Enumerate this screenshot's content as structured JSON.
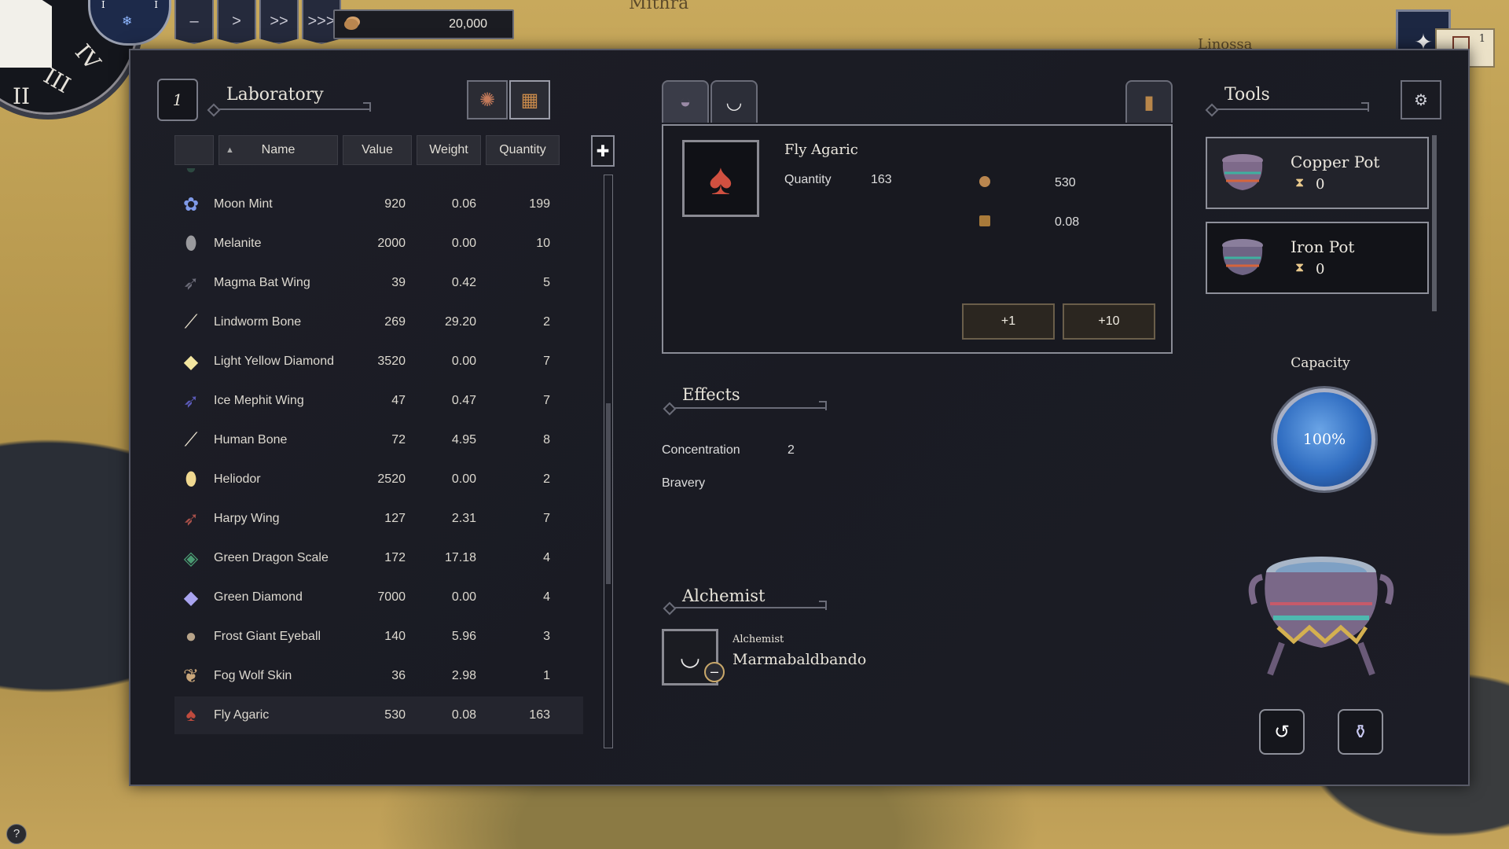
{
  "map": {
    "labels": [
      "Mithra",
      "Linossa"
    ]
  },
  "clock": {
    "numerals": [
      "II",
      "III",
      "IV"
    ],
    "dial_left": "I",
    "dial_right": "I"
  },
  "speed": {
    "buttons": [
      "–",
      ">",
      ">>",
      ">>>"
    ]
  },
  "money": {
    "amount": "20,000"
  },
  "book": {
    "count": "1"
  },
  "laboratory": {
    "badge": "1",
    "title": "Laboratory",
    "columns": [
      "Name",
      "Value",
      "Weight",
      "Quantity"
    ],
    "sort_indicator": "▲",
    "rows": [
      {
        "name": "Moon Mint",
        "value": "920",
        "weight": "0.06",
        "qty": "199",
        "icon": "moon-mint-icon",
        "glyph": "✿",
        "color": "#7f9ae8"
      },
      {
        "name": "Melanite",
        "value": "2000",
        "weight": "0.00",
        "qty": "10",
        "icon": "melanite-icon",
        "glyph": "⬮",
        "color": "#9a9a9e"
      },
      {
        "name": "Magma Bat Wing",
        "value": "39",
        "weight": "0.42",
        "qty": "5",
        "icon": "magma-bat-wing-icon",
        "glyph": "➶",
        "color": "#6b6b78"
      },
      {
        "name": "Lindworm Bone",
        "value": "269",
        "weight": "29.20",
        "qty": "2",
        "icon": "lindworm-bone-icon",
        "glyph": "⟋",
        "color": "#e8e0cc"
      },
      {
        "name": "Light Yellow Diamond",
        "value": "3520",
        "weight": "0.00",
        "qty": "7",
        "icon": "light-yellow-diamond-icon",
        "glyph": "◆",
        "color": "#f3e6a0"
      },
      {
        "name": "Ice Mephit Wing",
        "value": "47",
        "weight": "0.47",
        "qty": "7",
        "icon": "ice-mephit-wing-icon",
        "glyph": "➶",
        "color": "#5b5ab8"
      },
      {
        "name": "Human Bone",
        "value": "72",
        "weight": "4.95",
        "qty": "8",
        "icon": "human-bone-icon",
        "glyph": "⟋",
        "color": "#eee6d2"
      },
      {
        "name": "Heliodor",
        "value": "2520",
        "weight": "0.00",
        "qty": "2",
        "icon": "heliodor-icon",
        "glyph": "⬮",
        "color": "#f0d890"
      },
      {
        "name": "Harpy Wing",
        "value": "127",
        "weight": "2.31",
        "qty": "7",
        "icon": "harpy-wing-icon",
        "glyph": "➶",
        "color": "#a8504a"
      },
      {
        "name": "Green Dragon Scale",
        "value": "172",
        "weight": "17.18",
        "qty": "4",
        "icon": "green-dragon-scale-icon",
        "glyph": "◈",
        "color": "#4a9a72"
      },
      {
        "name": "Green Diamond",
        "value": "7000",
        "weight": "0.00",
        "qty": "4",
        "icon": "green-diamond-icon",
        "glyph": "◆",
        "color": "#a9a4f0"
      },
      {
        "name": "Frost Giant Eyeball",
        "value": "140",
        "weight": "5.96",
        "qty": "3",
        "icon": "frost-giant-eyeball-icon",
        "glyph": "●",
        "color": "#b8a48a"
      },
      {
        "name": "Fog Wolf Skin",
        "value": "36",
        "weight": "2.98",
        "qty": "1",
        "icon": "fog-wolf-skin-icon",
        "glyph": "❦",
        "color": "#c9a67a"
      },
      {
        "name": "Fly Agaric",
        "value": "530",
        "weight": "0.08",
        "qty": "163",
        "icon": "fly-agaric-icon",
        "glyph": "♠",
        "color": "#c04b3e"
      }
    ]
  },
  "detail": {
    "item_name": "Fly Agaric",
    "quantity_label": "Quantity",
    "quantity": "163",
    "value": "530",
    "weight": "0.08",
    "add_one": "+1",
    "add_ten": "+10"
  },
  "effects": {
    "title": "Effects",
    "items": [
      {
        "name": "Concentration",
        "level": "2"
      },
      {
        "name": "Bravery",
        "level": ""
      }
    ]
  },
  "alchemist": {
    "title": "Alchemist",
    "role": "Alchemist",
    "name": "Marmabaldbando",
    "remove": "–"
  },
  "tools": {
    "title": "Tools",
    "items": [
      {
        "name": "Copper Pot",
        "time": "0"
      },
      {
        "name": "Iron Pot",
        "time": "0"
      }
    ]
  },
  "capacity": {
    "label": "Capacity",
    "value": "100%"
  },
  "help": "?",
  "colors": {
    "panel": "#1c1d26",
    "accent_gold": "#c9a86a",
    "orb_blue": "#2f6cc0"
  }
}
